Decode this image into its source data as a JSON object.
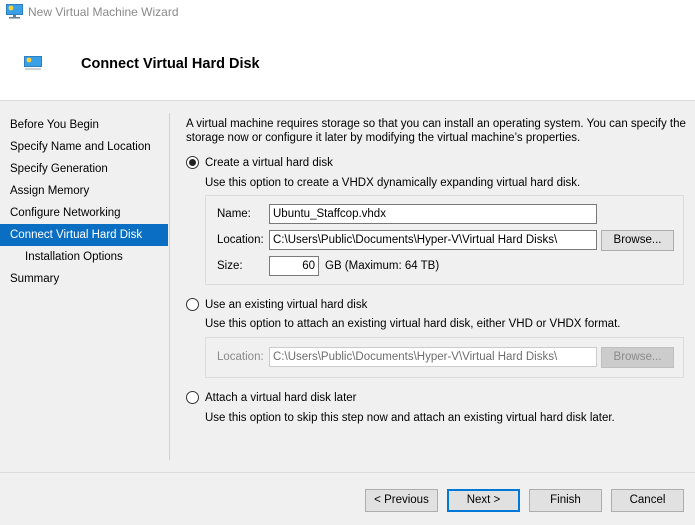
{
  "window": {
    "title": "New Virtual Machine Wizard",
    "icon": "virtual-machine-monitor-icon"
  },
  "header": {
    "title": "Connect Virtual Hard Disk",
    "icon": "virtual-machine-monitor-icon"
  },
  "nav": {
    "items": [
      {
        "label": "Before You Begin",
        "active": false,
        "sub": false
      },
      {
        "label": "Specify Name and Location",
        "active": false,
        "sub": false
      },
      {
        "label": "Specify Generation",
        "active": false,
        "sub": false
      },
      {
        "label": "Assign Memory",
        "active": false,
        "sub": false
      },
      {
        "label": "Configure Networking",
        "active": false,
        "sub": false
      },
      {
        "label": "Connect Virtual Hard Disk",
        "active": true,
        "sub": false
      },
      {
        "label": "Installation Options",
        "active": false,
        "sub": true
      },
      {
        "label": "Summary",
        "active": false,
        "sub": false
      }
    ],
    "active_color": "#0a6fc2"
  },
  "content": {
    "intro": "A virtual machine requires storage so that you can install an operating system. You can specify the storage now or configure it later by modifying the virtual machine’s properties.",
    "option_create": {
      "label": "Create a virtual hard disk",
      "selected": true,
      "description": "Use this option to create a VHDX dynamically expanding virtual hard disk.",
      "name_label": "Name:",
      "name_value": "Ubuntu_Staffcop.vhdx",
      "location_label": "Location:",
      "location_value": "C:\\Users\\Public\\Documents\\Hyper-V\\Virtual Hard Disks\\",
      "browse_label": "Browse...",
      "size_label": "Size:",
      "size_value": "60",
      "size_suffix": "GB (Maximum: 64 TB)"
    },
    "option_existing": {
      "label": "Use an existing virtual hard disk",
      "selected": false,
      "description": "Use this option to attach an existing virtual hard disk, either VHD or VHDX format.",
      "location_label": "Location:",
      "location_value": "C:\\Users\\Public\\Documents\\Hyper-V\\Virtual Hard Disks\\",
      "browse_label": "Browse..."
    },
    "option_later": {
      "label": "Attach a virtual hard disk later",
      "selected": false,
      "description": "Use this option to skip this step now and attach an existing virtual hard disk later."
    }
  },
  "footer": {
    "previous_label": "< Previous",
    "next_label": "Next >",
    "finish_label": "Finish",
    "cancel_label": "Cancel",
    "focus_color": "#0078d7"
  }
}
